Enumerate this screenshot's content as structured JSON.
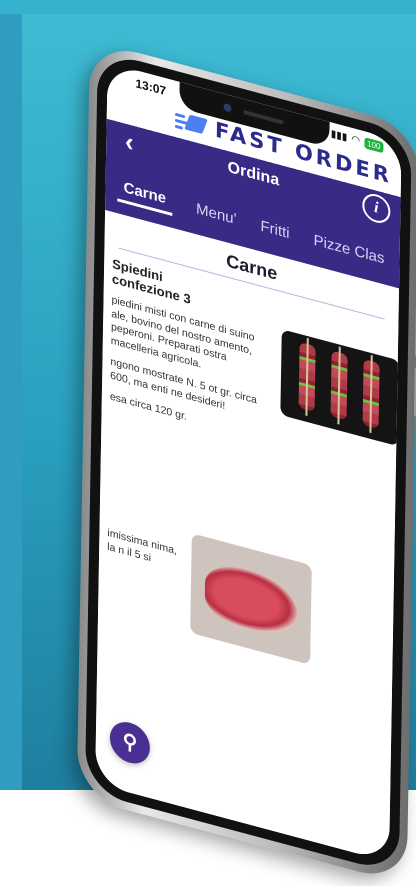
{
  "status": {
    "time": "13:07",
    "battery": "100"
  },
  "app": {
    "logo_text": "FAST ORDER"
  },
  "topbar": {
    "back_icon": "chevron-left-icon",
    "title": "Ordina",
    "info_icon": "info-icon"
  },
  "tabs": [
    {
      "label": "Carne",
      "active": true
    },
    {
      "label": "Menu'",
      "active": false
    },
    {
      "label": "Fritti",
      "active": false
    },
    {
      "label": "Pizze Clas",
      "active": false
    }
  ],
  "section": {
    "title": "Carne"
  },
  "products": [
    {
      "name_line1": "Spiedini",
      "name_line2": "confezione 3",
      "desc1": "piedini misti con carne di suino ale, bovino del nostro amento, peperoni. Preparati ostra macelleria agricola.",
      "desc2": "ngono mostrate N. 5 ot gr. circa 600, ma enti ne desideri!",
      "desc3": "esa circa 120 gr."
    },
    {
      "desc": "imissima nima, la n il 5 si"
    }
  ],
  "fab": {
    "icon": "search-icon"
  }
}
